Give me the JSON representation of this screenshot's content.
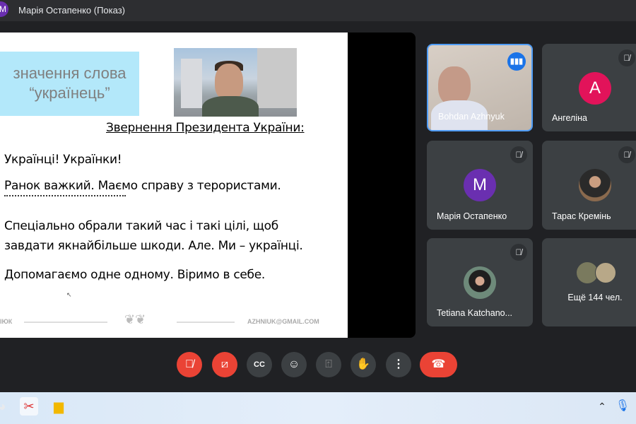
{
  "header": {
    "presenter_initial": "M",
    "title": "Марія Остапенко (Показ)"
  },
  "slide": {
    "title_line1": "значення слова",
    "title_line2": "“українець”",
    "heading": "Звернення Президента України:",
    "lines": [
      "Українці! Українки!",
      "Ранок важкий. Маємо справу з терористами.",
      "Спеціально обрали такий час і такі цілі, щоб",
      "завдати якнайбільше шкоди. Але. Ми – українці.",
      "Допомагаємо одне одному. Віримо в себе."
    ],
    "footer_left": "ІЮК",
    "footer_email": "AZHNIUK@GMAIL.COM"
  },
  "participants": [
    {
      "name": "Bohdan Azhnyuk",
      "status": "speaking"
    },
    {
      "name": "Ангеліна",
      "initial": "A",
      "color": "#e2135a",
      "status": "muted"
    },
    {
      "name": "Марія Остапенко",
      "initial": "M",
      "color": "#6a2fb0",
      "status": "muted"
    },
    {
      "name": "Тарас Кремінь",
      "status": "muted"
    },
    {
      "name": "Tetiana Katchano...",
      "status": "muted"
    },
    {
      "name": "Ещё 144 чел."
    }
  ],
  "controls": [
    "mic-off",
    "camera-off",
    "captions",
    "emoji",
    "present",
    "raise-hand",
    "more",
    "end-call"
  ],
  "colors": {
    "accent": "#1a73e8",
    "danger": "#ea4335",
    "tile": "#3c4043",
    "background": "#202124"
  }
}
